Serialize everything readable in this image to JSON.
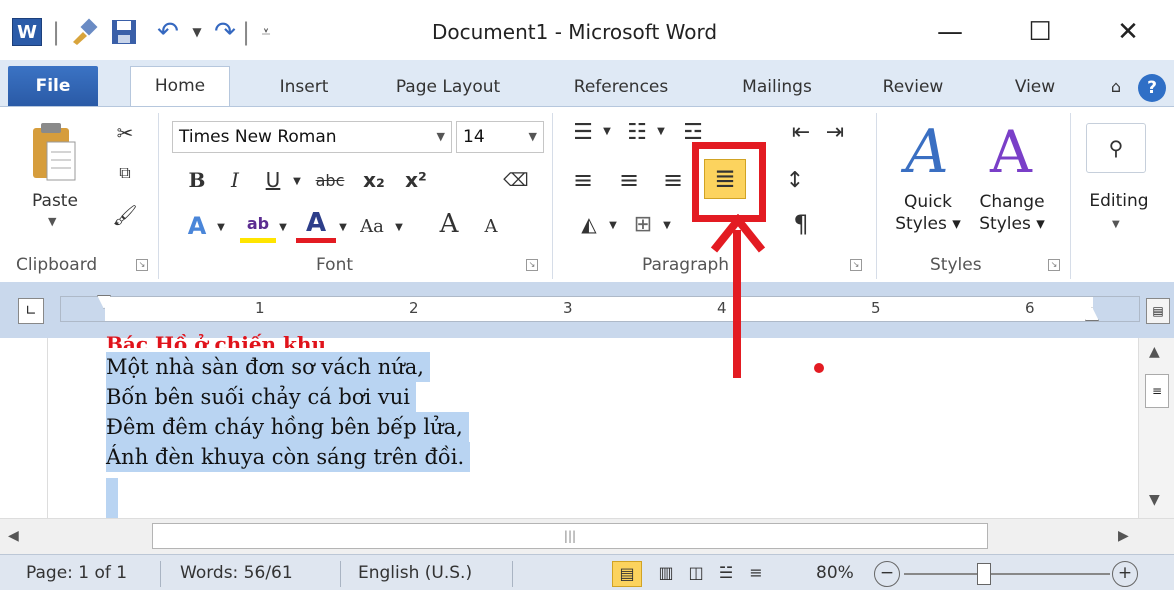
{
  "window": {
    "title": "Document1  -  Microsoft Word",
    "minimize": "—",
    "maximize": "☐",
    "close": "✕"
  },
  "quick_access": [
    "W",
    "✎",
    "💾",
    "↶",
    "↷"
  ],
  "tabs": {
    "file": "File",
    "home": "Home",
    "insert": "Insert",
    "page_layout": "Page Layout",
    "references": "References",
    "mailings": "Mailings",
    "review": "Review",
    "view": "View",
    "help": "?"
  },
  "ribbon": {
    "clipboard": {
      "paste": "Paste",
      "label": "Clipboard"
    },
    "font": {
      "name": "Times New Roman",
      "size": "14",
      "bold": "B",
      "italic": "I",
      "underline": "U",
      "strike": "abc",
      "subscript": "x₂",
      "superscript": "x²",
      "highlight": "ab",
      "color": "A",
      "case": "Aa",
      "grow": "A",
      "shrink": "A",
      "label": "Font"
    },
    "paragraph": {
      "pilcrow": "¶",
      "label": "Paragraph"
    },
    "styles": {
      "quick": "Quick\nStyles",
      "quick_1": "Quick",
      "quick_2": "Styles ▾",
      "change_1": "Change",
      "change_2": "Styles ▾",
      "label": "Styles"
    },
    "editing": {
      "label": "Editing"
    }
  },
  "ruler": {
    "marks": [
      "1",
      "2",
      "3",
      "4",
      "5",
      "6"
    ]
  },
  "document": {
    "title": "Bác Hồ ở chiến khu",
    "lines": [
      "Một nhà sàn đơn sơ vách nứa,",
      "Bốn bên suối chảy cá bơi vui",
      "Đêm đêm cháy hồng bên bếp lửa,",
      "Ánh đèn khuya còn sáng trên đồi."
    ]
  },
  "statusbar": {
    "page": "Page: 1 of 1",
    "words": "Words: 56/61",
    "language": "English (U.S.)",
    "zoom": "80%",
    "zoom_level": 0.8
  },
  "colors": {
    "annotation": "#e31b22",
    "selection": "#b9d4f2",
    "ribbon_tabs": "#dfe9f5",
    "file_tab": "#2f65b5"
  }
}
